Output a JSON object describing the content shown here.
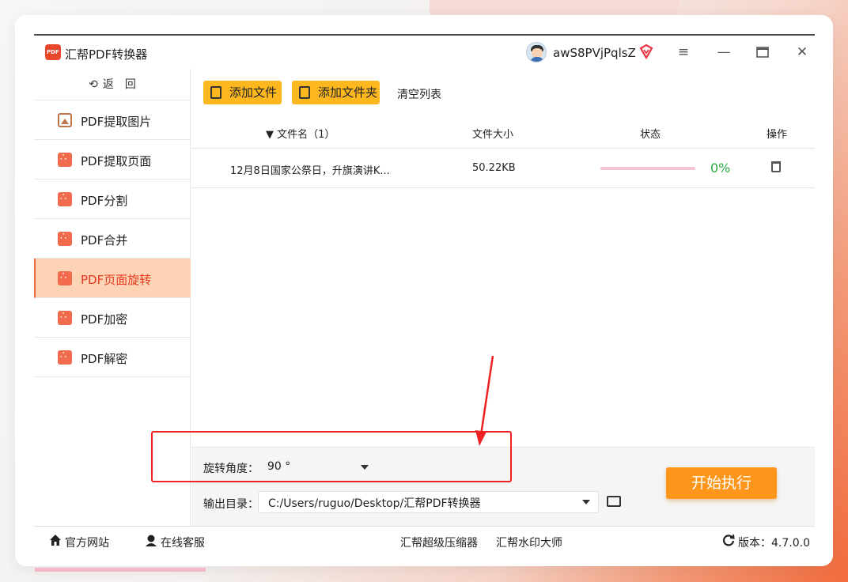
{
  "app": {
    "title": "汇帮PDF转换器",
    "username": "awS8PVjPqlsZ"
  },
  "sidebar": {
    "back_label": "返　回",
    "items": [
      {
        "label": "PDF提取图片",
        "icon": "image-icon",
        "active": false
      },
      {
        "label": "PDF提取页面",
        "icon": "pdf-icon",
        "active": false
      },
      {
        "label": "PDF分割",
        "icon": "pdf-icon",
        "active": false
      },
      {
        "label": "PDF合并",
        "icon": "pdf-icon",
        "active": false
      },
      {
        "label": "PDF页面旋转",
        "icon": "pdf-icon",
        "active": true
      },
      {
        "label": "PDF加密",
        "icon": "pdf-icon",
        "active": false
      },
      {
        "label": "PDF解密",
        "icon": "pdf-icon",
        "active": false
      }
    ]
  },
  "toolbar": {
    "add_file": "添加文件",
    "add_folder": "添加文件夹",
    "clear_list": "清空列表"
  },
  "table": {
    "headers": {
      "filename": "▼ 文件名（1）",
      "size": "文件大小",
      "status": "状态",
      "action": "操作"
    },
    "rows": [
      {
        "filename": "12月8日国家公祭日，升旗演讲K...",
        "size": "50.22KB",
        "progress": "0%"
      }
    ]
  },
  "settings": {
    "angle_label": "旋转角度：",
    "angle_value": "90 °",
    "output_label": "输出目录：",
    "output_value": "C:/Users/ruguo/Desktop/汇帮PDF转换器"
  },
  "start_button": "开始执行",
  "footer": {
    "website": "官方网站",
    "support": "在线客服",
    "link1": "汇帮超级压缩器",
    "link2": "汇帮水印大师",
    "version": "版本：4.7.0.0"
  },
  "colors": {
    "accent": "#fd961a",
    "active_bg": "#fcd3b5",
    "active_text": "#e8381e",
    "highlight": "#e22222"
  }
}
